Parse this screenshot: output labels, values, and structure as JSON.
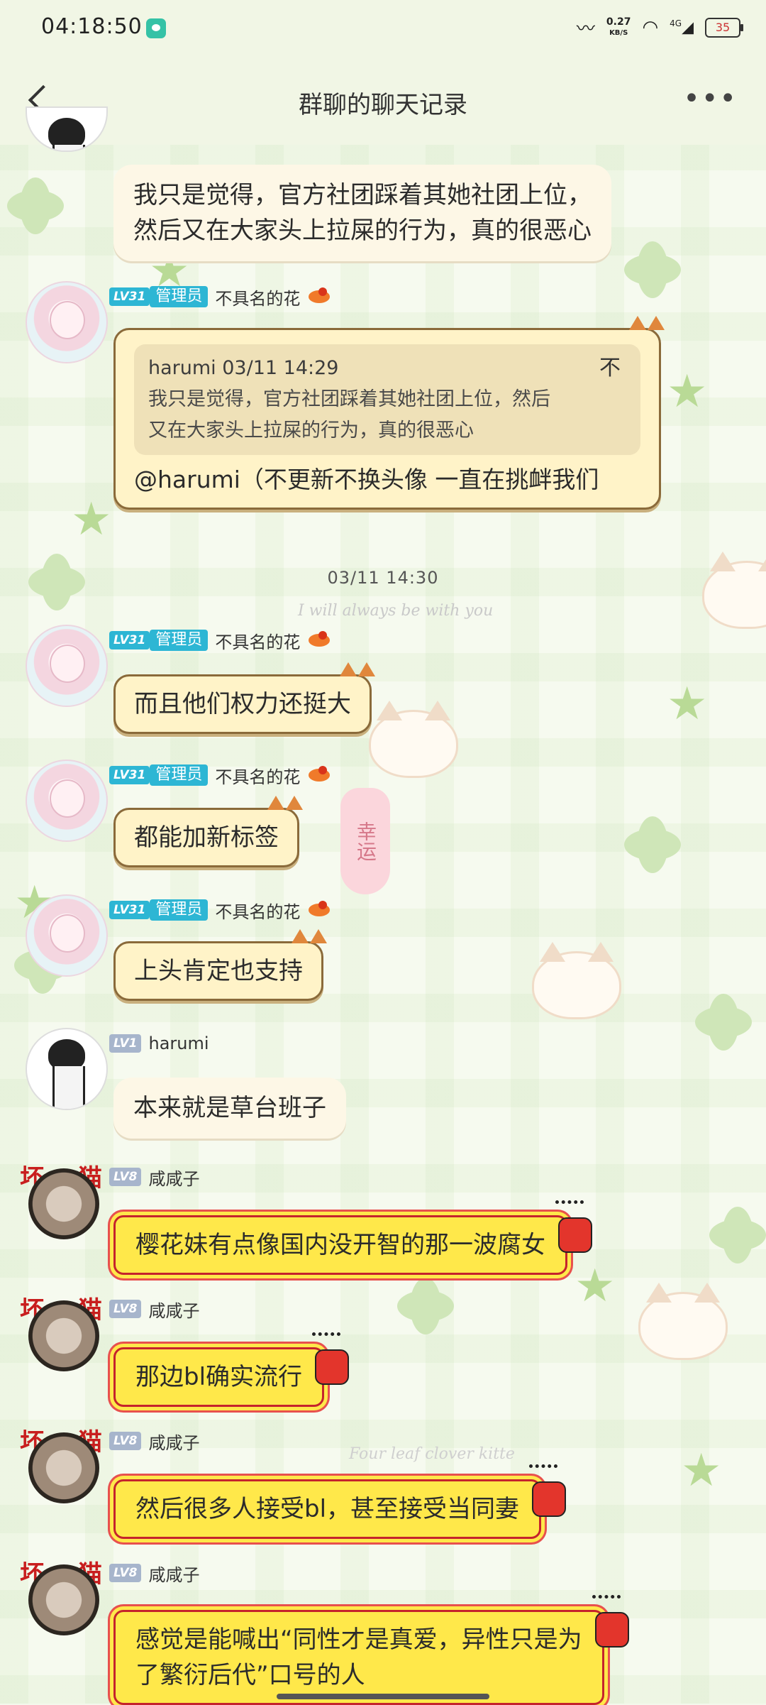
{
  "status_bar": {
    "time": "04:18:50",
    "net_speed_value": "0.27",
    "net_speed_unit": "KB/S",
    "network": "4G",
    "battery": "35"
  },
  "header": {
    "title": "群聊的聊天记录"
  },
  "messages": [
    {
      "user": "harumi",
      "text_line1": "我只是觉得，官方社团踩着其她社团上位，",
      "text_line2": "然后又在大家头上拉屎的行为，真的很恶心"
    },
    {
      "level": "LV31",
      "role": "管理员",
      "user": "不具名的花",
      "quote_header": "harumi 03/11 14:29",
      "quote_tail": "不",
      "quote_line1": "我只是觉得，官方社团踩着其她社团上位，然后",
      "quote_line2": "又在大家头上拉屎的行为，真的很恶心",
      "text": "@harumi（不更新不换头像 一直在挑衅我们"
    },
    {
      "level": "LV31",
      "role": "管理员",
      "user": "不具名的花",
      "text": "而且他们权力还挺大"
    },
    {
      "level": "LV31",
      "role": "管理员",
      "user": "不具名的花",
      "text": "都能加新标签"
    },
    {
      "level": "LV31",
      "role": "管理员",
      "user": "不具名的花",
      "text": "上头肯定也支持"
    },
    {
      "level": "LV1",
      "user": "harumi",
      "text": "本来就是草台班子"
    },
    {
      "level": "LV8",
      "user": "咸咸子",
      "avatar_deco": "坏猫",
      "text": "樱花妹有点像国内没开智的那一波腐女"
    },
    {
      "level": "LV8",
      "user": "咸咸子",
      "avatar_deco": "坏猫",
      "text": "那边bl确实流行"
    },
    {
      "level": "LV8",
      "user": "咸咸子",
      "avatar_deco": "坏猫",
      "text": "然后很多人接受bl，甚至接受当同妻"
    },
    {
      "level": "LV8",
      "user": "咸咸子",
      "avatar_deco": "坏猫",
      "text_line1": "感觉是能喊出“同性才是真爱，异性只是为",
      "text_line2": "了繁衍后代”口号的人"
    }
  ],
  "timestamp": "03/11 14:30",
  "background_text": {
    "line1": "I will always be with you",
    "line2": "Four leaf clover kitte",
    "charm": "幸运"
  },
  "colors": {
    "header_bg": "#f1f6e5",
    "admin_badge": "#2db6d4",
    "cat_bubble": "#fff3c8",
    "red_bubble_fill": "#ffe84a",
    "red_bubble_border": "#c5232c"
  },
  "icons": [
    "back-arrow-icon",
    "more-dots-icon",
    "network-speed-icon",
    "wifi-icon",
    "signal-icon",
    "battery-icon",
    "reply-arrow-icon",
    "dragon-badge-icon",
    "thumbs-up-icon"
  ]
}
